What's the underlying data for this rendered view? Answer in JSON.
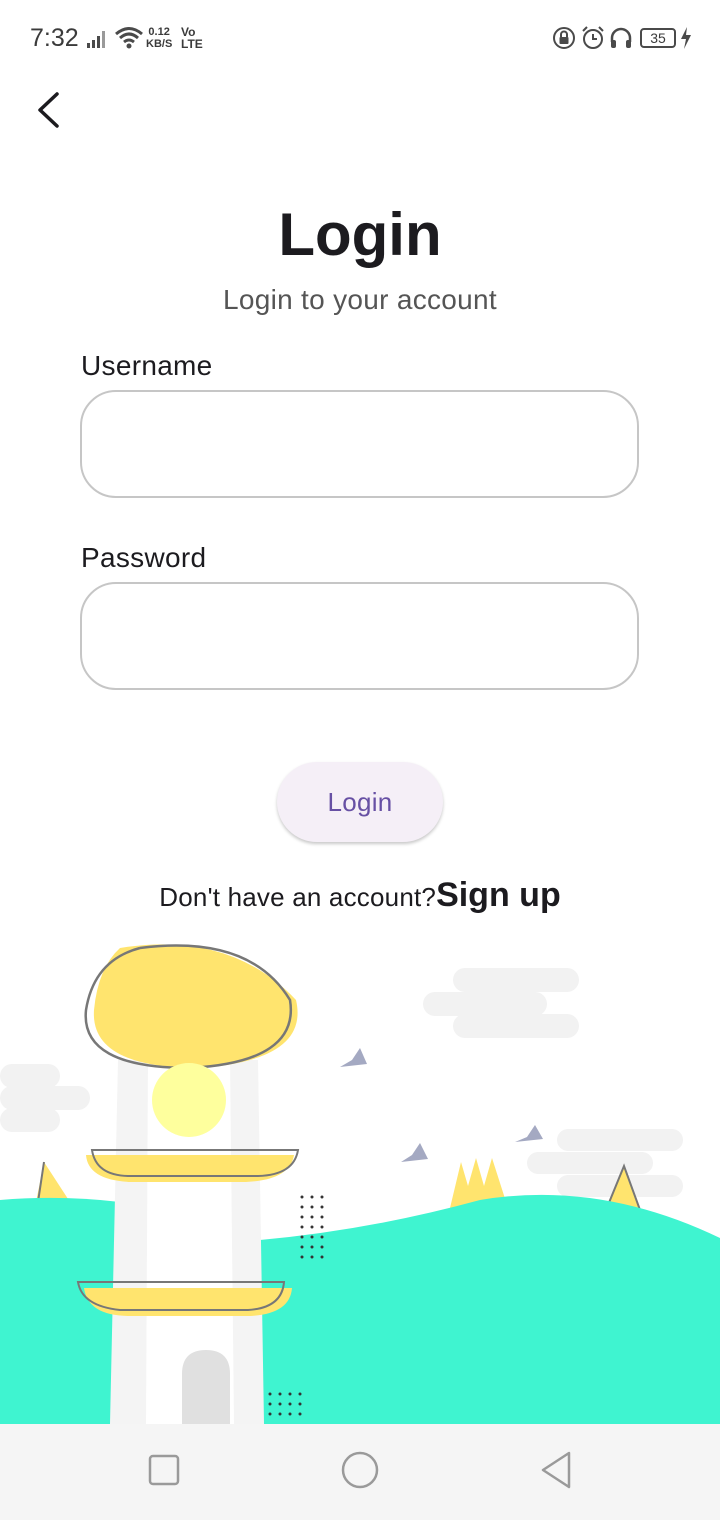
{
  "status_bar": {
    "time": "7:32",
    "speed_value": "0.12",
    "speed_unit": "KB/S",
    "volte_top": "Vo",
    "volte_bottom": "LTE",
    "battery_level": "35"
  },
  "header": {
    "title": "Login",
    "subtitle": "Login to your account"
  },
  "form": {
    "username_label": "Username",
    "username_value": "",
    "password_label": "Password",
    "password_value": "",
    "login_label": "Login"
  },
  "signup": {
    "prompt": "Don't have an account?",
    "link": "Sign up"
  },
  "colors": {
    "accent": "#6750a4",
    "button_bg": "#f5eff7",
    "hill": "#3ff4d0",
    "lighthouse_yellow": "#ffe46e"
  },
  "icons": [
    "back-arrow-icon",
    "recent-apps-icon",
    "home-icon",
    "back-nav-icon"
  ]
}
